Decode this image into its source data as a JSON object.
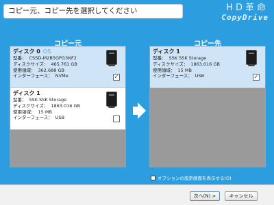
{
  "header": {
    "instruction": "コピー元、コピー先を選択してください",
    "logo_top": "HD革命",
    "logo_bottom": "CopyDrive"
  },
  "source": {
    "title": "コピー元",
    "disks": [
      {
        "name": "ディスク 0",
        "badge": "OS",
        "model_label": "型番",
        "model": "CSSD-M2B5GPG3NF2",
        "size_label": "ディスクサイズ",
        "size": "465.761 GB",
        "used_label": "使用領域",
        "used": "362.688 GB",
        "interface_label": "インターフェース",
        "interface": "NVMe",
        "checked": true,
        "checkbox_glyph": "✓"
      },
      {
        "name": "ディスク 1",
        "badge": "",
        "model_label": "型番",
        "model": "SSK      SSK Storage",
        "size_label": "ディスクサイズ",
        "size": "1863.016 GB",
        "used_label": "使用領域",
        "used": "15 MB",
        "interface_label": "インターフェース",
        "interface": "USB",
        "checked": false,
        "checkbox_glyph": ""
      }
    ]
  },
  "destination": {
    "title": "コピー先",
    "disks": [
      {
        "name": "ディスク 1",
        "model_label": "型番",
        "model": "SSK      SSK Storage",
        "size_label": "ディスクサイズ",
        "size": "1863.016 GB",
        "used_label": "使用領域",
        "used": "15 MB",
        "interface_label": "インターフェース",
        "interface": "USB",
        "checked": true,
        "checkbox_glyph": "✓"
      }
    ]
  },
  "option": {
    "label": "オプションの設定画面を表示する(O)",
    "checked": false
  },
  "buttons": {
    "next": "次へ(N) >",
    "cancel": "キャンセル"
  }
}
